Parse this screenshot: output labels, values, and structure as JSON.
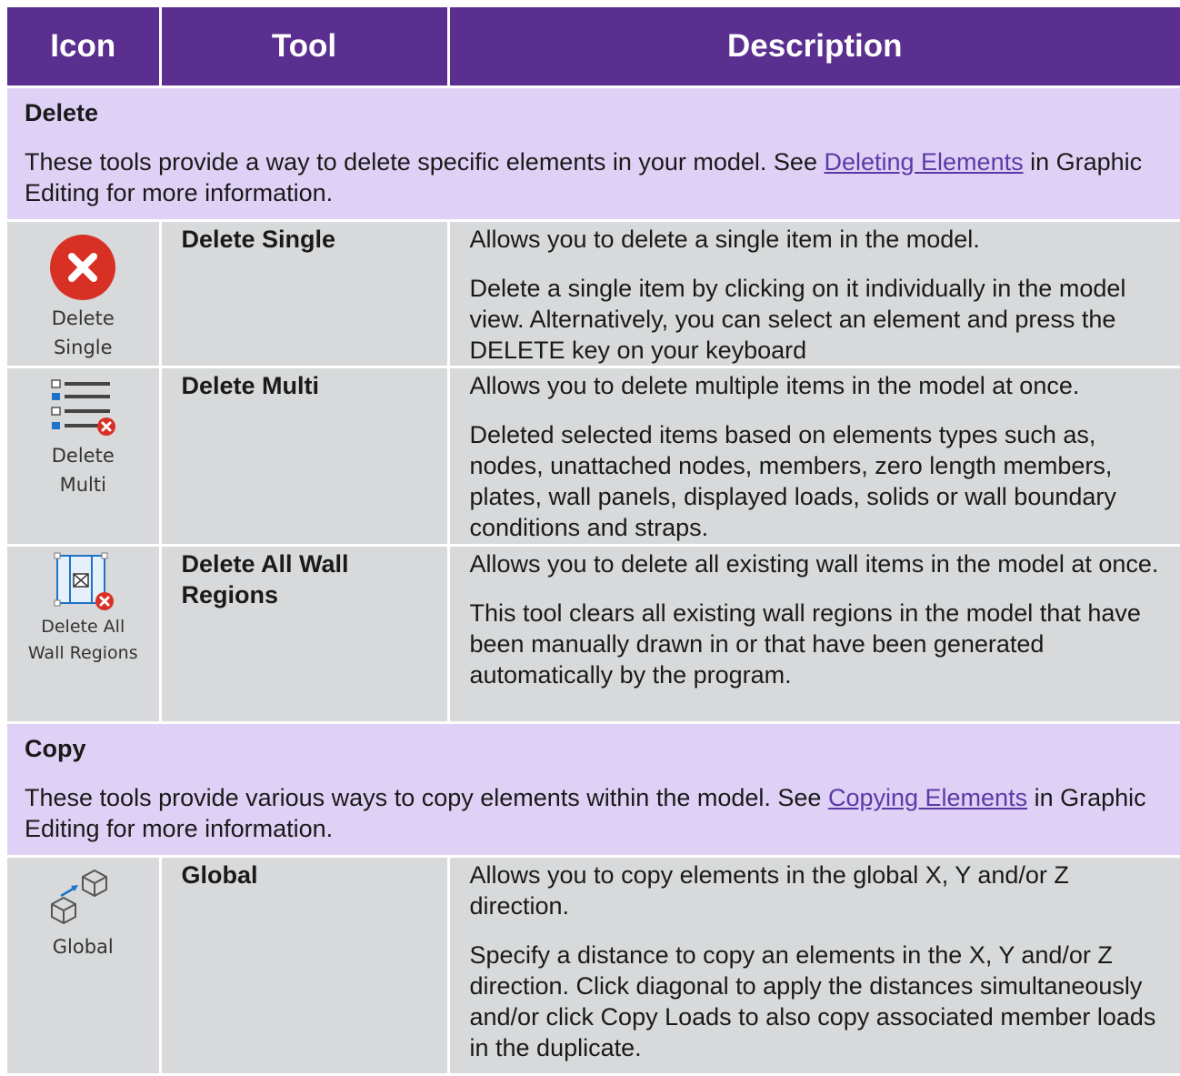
{
  "header": {
    "icon": "Icon",
    "tool": "Tool",
    "description": "Description"
  },
  "sections": [
    {
      "title": "Delete",
      "intro_before": "These tools provide a way to delete specific elements in your model. See ",
      "intro_link": "Deleting Elements",
      "intro_after": " in Graphic Editing for more information.",
      "rows": [
        {
          "icon": "delete-single-icon",
          "icon_label": "Delete\nSingle",
          "tool": "Delete Single",
          "desc": [
            "Allows you to delete a single item in the model.",
            "Delete a single item by clicking on it individually in the model view. Alternatively, you can select an element and press the DELETE key on your keyboard"
          ]
        },
        {
          "icon": "delete-multi-icon",
          "icon_label": "Delete\nMulti",
          "tool": "Delete Multi",
          "desc": [
            "Allows you to delete multiple items in the model at once.",
            "Deleted selected items based on elements types such as, nodes, unattached nodes, members, zero length members, plates, wall panels, displayed loads, solids or wall boundary conditions and straps."
          ]
        },
        {
          "icon": "delete-wall-regions-icon",
          "icon_label": "Delete All\nWall Regions",
          "tool": "Delete All Wall Regions",
          "desc": [
            "Allows you to delete all existing wall items in the model at once.",
            "This tool clears all existing wall regions in the model that have been manually drawn in or that have been generated automatically by the program."
          ]
        }
      ]
    },
    {
      "title": "Copy",
      "intro_before": "These tools provide various ways to copy elements within the model. See ",
      "intro_link": "Copying Elements",
      "intro_after": " in Graphic Editing for more information.",
      "rows": [
        {
          "icon": "copy-global-icon",
          "icon_label": "Global",
          "tool": "Global",
          "desc": [
            "Allows you to copy elements in the global X, Y and/or Z direction.",
            "Specify a distance to copy an elements in the X, Y and/or Z direction. Click diagonal to apply the distances simultaneously and/or click Copy Loads to also copy associated member loads in the duplicate."
          ]
        }
      ]
    }
  ],
  "colors": {
    "header_bg": "#5a2f8f",
    "section_bg": "#dfd1f5",
    "row_bg": "#d7d9da",
    "link": "#5b3aa8",
    "delete_red": "#d93025",
    "accent_blue": "#1e73c8"
  }
}
